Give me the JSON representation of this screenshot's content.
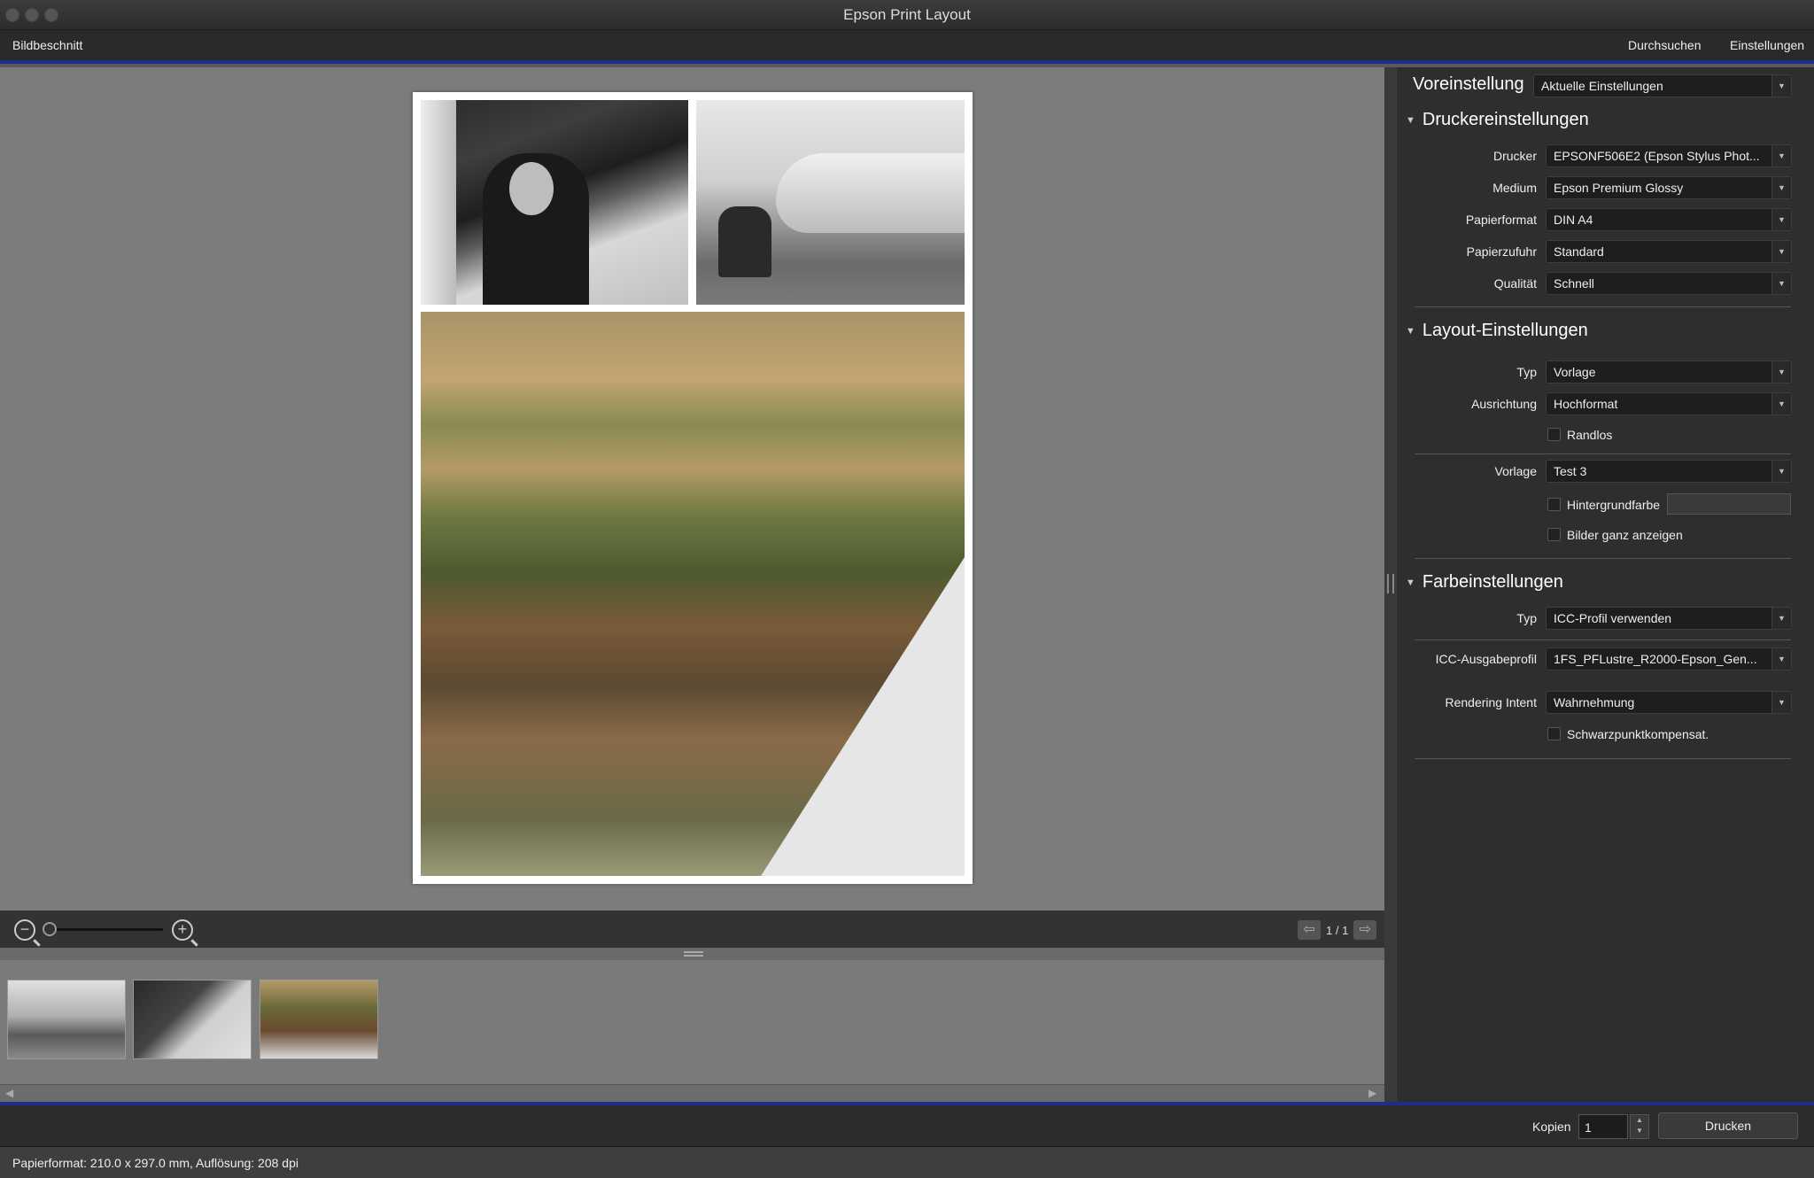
{
  "window": {
    "title": "Epson Print Layout"
  },
  "toolbar": {
    "left": "Bildbeschnitt",
    "browse": "Durchsuchen",
    "settings": "Einstellungen"
  },
  "preview": {
    "page_indicator": "1 / 1",
    "zoom_level": 0.0
  },
  "panel": {
    "preset": {
      "label": "Voreinstellung",
      "value": "Aktuelle Einstellungen"
    },
    "printer_section": {
      "title": "Druckereinstellungen",
      "printer": {
        "label": "Drucker",
        "value": "EPSONF506E2 (Epson Stylus Phot..."
      },
      "medium": {
        "label": "Medium",
        "value": "Epson Premium Glossy"
      },
      "paper_format": {
        "label": "Papierformat",
        "value": "DIN A4"
      },
      "paper_feed": {
        "label": "Papierzufuhr",
        "value": "Standard"
      },
      "quality": {
        "label": "Qualität",
        "value": "Schnell"
      }
    },
    "layout_section": {
      "title": "Layout-Einstellungen",
      "type": {
        "label": "Typ",
        "value": "Vorlage"
      },
      "orientation": {
        "label": "Ausrichtung",
        "value": "Hochformat"
      },
      "borderless": {
        "label": "Randlos",
        "checked": false
      },
      "template": {
        "label": "Vorlage",
        "value": "Test 3"
      },
      "background_color": {
        "label": "Hintergrundfarbe",
        "checked": false
      },
      "show_full_images": {
        "label": "Bilder ganz anzeigen",
        "checked": false
      }
    },
    "color_section": {
      "title": "Farbeinstellungen",
      "type": {
        "label": "Typ",
        "value": "ICC-Profil verwenden"
      },
      "icc_profile": {
        "label": "ICC-Ausgabeprofil",
        "value": "1FS_PFLustre_R2000-Epson_Gen..."
      },
      "rendering_intent": {
        "label": "Rendering Intent",
        "value": "Wahrnehmung"
      },
      "black_point": {
        "label": "Schwarzpunktkompensat.",
        "checked": false
      }
    }
  },
  "printbar": {
    "copies_label": "Kopien",
    "copies_value": "1",
    "print_button": "Drucken"
  },
  "status": {
    "text": "Papierformat: 210.0 x 297.0 mm,   Auflösung: 208 dpi"
  },
  "icons": {
    "zoom_out": "zoom-out-icon",
    "zoom_in": "zoom-in-icon",
    "prev": "arrow-left-icon",
    "next": "arrow-right-icon"
  },
  "colors": {
    "accent": "#1c2f8a",
    "panel": "#2e2e2e",
    "preview_bg": "#7c7c7c"
  }
}
